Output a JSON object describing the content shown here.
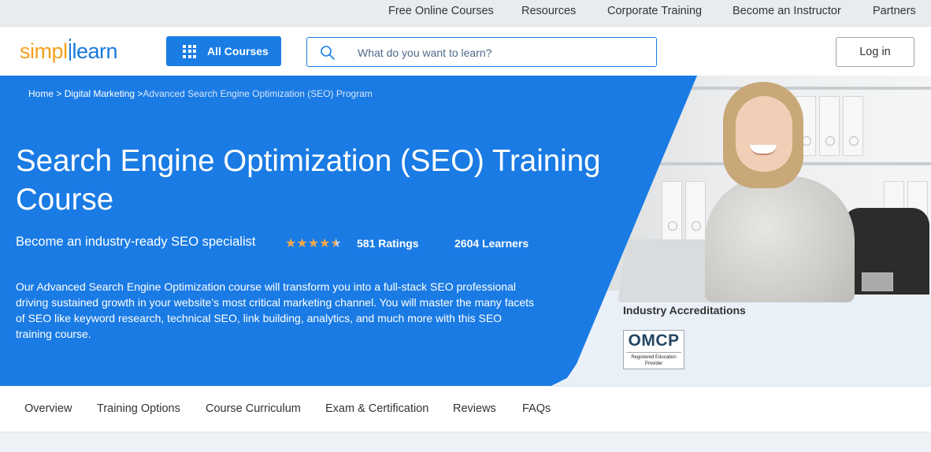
{
  "topbar": {
    "links": [
      "Free Online Courses",
      "Resources",
      "Corporate Training",
      "Become an Instructor",
      "Partners"
    ]
  },
  "header": {
    "logo_part1": "simpl",
    "logo_part2": "learn",
    "all_courses_label": "All Courses",
    "search_placeholder": "What do you want to learn?",
    "login_label": "Log in"
  },
  "breadcrumb": {
    "home": "Home",
    "sep1": " > ",
    "category": "Digital Marketing",
    "sep2": " >",
    "current": "Advanced Search Engine Optimization (SEO) Program"
  },
  "hero": {
    "title": "Search Engine Optimization (SEO) Training Course",
    "subtitle": "Become an industry-ready SEO specialist",
    "rating_stars": 4.5,
    "ratings_text": "581 Ratings",
    "learners_text": "2604 Learners",
    "description": "Our Advanced Search Engine Optimization course will transform you into a full-stack SEO professional driving sustained growth in your website’s most critical marketing channel. You will master the many facets of SEO like keyword research, technical SEO, link building, analytics, and much more with this SEO training course."
  },
  "accreditations": {
    "heading": "Industry Accreditations",
    "badge_title": "OMCP",
    "badge_subtitle": "Registered Education Provider"
  },
  "tabs": [
    "Overview",
    "Training Options",
    "Course Curriculum",
    "Exam & Certification",
    "Reviews",
    "FAQs"
  ],
  "colors": {
    "brand_blue": "#1a7be4",
    "brand_orange": "#f4a01c",
    "star": "#f6a94a"
  }
}
